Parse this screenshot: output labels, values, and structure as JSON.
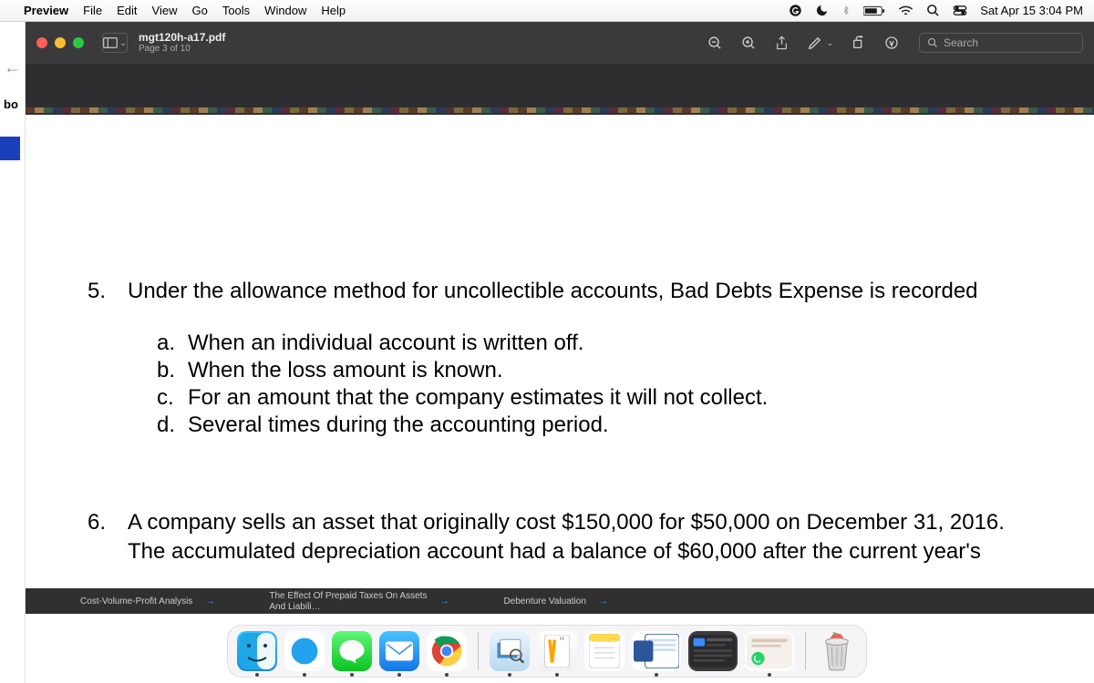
{
  "menubar": {
    "app": "Preview",
    "items": [
      "File",
      "Edit",
      "View",
      "Go",
      "Tools",
      "Window",
      "Help"
    ],
    "clock": "Sat Apr 15  3:04 PM"
  },
  "left_strip": {
    "bo_text": "bo"
  },
  "toolbar": {
    "filename": "mgt120h-a17.pdf",
    "page_info": "Page 3 of 10",
    "search_placeholder": "Search"
  },
  "document": {
    "q5": {
      "num": "5.",
      "text": "Under the allowance method for uncollectible accounts, Bad Debts Expense is recorded",
      "opts": [
        {
          "l": "a.",
          "t": "When an individual account is written off."
        },
        {
          "l": "b.",
          "t": "When the loss amount is known."
        },
        {
          "l": "c.",
          "t": "For an amount that the company estimates it will not collect."
        },
        {
          "l": "d.",
          "t": "Several times during the accounting period."
        }
      ]
    },
    "q6": {
      "num": "6.",
      "line1": "A company sells an asset that originally cost $150,000 for $50,000 on December 31, 2016.",
      "line2": "The accumulated depreciation account had a balance of $60,000 after the current year's"
    }
  },
  "tabs": {
    "t1": "Cost-Volume-Profit Analysis",
    "t2a": "The Effect Of Prepaid Taxes On Assets",
    "t2b": "And Liabili…",
    "t3": "Debenture Valuation"
  }
}
